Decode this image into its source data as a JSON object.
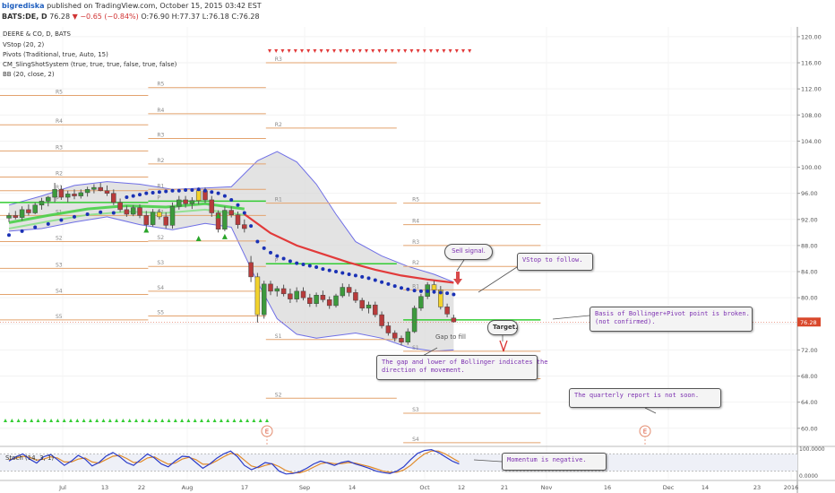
{
  "header": {
    "author": "bigrediska",
    "published": "published on TradingView.com, October 15, 2015 03:42 EST",
    "symbol": "BATS:DE, D",
    "last": "76.28",
    "change": "▼ −0.65 (−0.84%)",
    "ohlc": "O:76.90 H:77.37 L:76.18 C:76.28"
  },
  "indicators": [
    "DEERE & CO, D, BATS",
    "VStop (20, 2)",
    "Pivots (Traditional, true, Auto, 15)",
    "CM_SlingShotSystem (true, true, true, false, true, false)",
    "BB (20, close, 2)"
  ],
  "stoch_label": "Stoch (14, 3, 1)",
  "colors": {
    "up": "#3c9a3c",
    "down": "#b83b3b",
    "slingshot_yellow": "#f2d22c",
    "vstop": "#1a31b5",
    "ema_red": "#e23a3a",
    "ema_green": "#3fcf3f",
    "pivot_line": "#e3a36e",
    "pivot_p": "#33cc33",
    "bb_fill": "#d9d9d9",
    "bb_line": "#6f6fe6",
    "last_price": "#d9482b"
  },
  "annotations": {
    "sell_signal": "Sell signal.",
    "vstop": "VStop to follow.",
    "basis": "Basis of Bollinger+Pivot point is broken.\n(not confirmed).",
    "target": "Target.",
    "gap_fill": "Gap to fill",
    "gap_bollinger": "The gap and lower of Bollinger indicates the\ndirection of movement.",
    "quarterly": "The quarterly report  is not soon.",
    "momentum": "Momentum is negative.",
    "earnings": "E"
  },
  "chart_data": {
    "type": "candlestick",
    "title": "DEERE & CO, D, BATS",
    "y_range": [
      57.5,
      121.5
    ],
    "yticks": [
      60.0,
      64.0,
      68.0,
      72.0,
      76.0,
      80.0,
      84.0,
      88.0,
      92.0,
      96.0,
      100.0,
      104.0,
      108.0,
      112.0,
      116.0,
      120.0
    ],
    "x_ticks": [
      "Jul",
      "13",
      "22",
      "Aug",
      "17",
      "Sep",
      "14",
      "Oct",
      "12",
      "21",
      "Nov",
      "16",
      "Dec",
      "14",
      "23",
      "2016"
    ],
    "last_price": 76.28,
    "candles": [
      {
        "o": 92.2,
        "h": 93.0,
        "l": 91.6,
        "c": 92.6
      },
      {
        "o": 92.6,
        "h": 93.3,
        "l": 92.0,
        "c": 92.3
      },
      {
        "o": 92.3,
        "h": 94.0,
        "l": 91.8,
        "c": 93.5
      },
      {
        "o": 93.5,
        "h": 94.3,
        "l": 92.6,
        "c": 93.0
      },
      {
        "o": 93.0,
        "h": 94.6,
        "l": 92.8,
        "c": 94.2
      },
      {
        "o": 94.2,
        "h": 95.3,
        "l": 93.5,
        "c": 94.8
      },
      {
        "o": 94.8,
        "h": 95.6,
        "l": 94.0,
        "c": 95.4
      },
      {
        "o": 95.4,
        "h": 97.6,
        "l": 94.6,
        "c": 96.6
      },
      {
        "o": 96.6,
        "h": 97.2,
        "l": 95.0,
        "c": 95.4
      },
      {
        "o": 95.4,
        "h": 96.4,
        "l": 94.6,
        "c": 95.9
      },
      {
        "o": 95.9,
        "h": 96.6,
        "l": 95.1,
        "c": 95.6
      },
      {
        "o": 95.6,
        "h": 96.6,
        "l": 95.2,
        "c": 96.1
      },
      {
        "o": 96.1,
        "h": 97.0,
        "l": 95.5,
        "c": 96.6
      },
      {
        "o": 96.6,
        "h": 97.4,
        "l": 96.0,
        "c": 96.9
      },
      {
        "o": 96.9,
        "h": 97.6,
        "l": 96.3,
        "c": 96.4
      },
      {
        "o": 96.4,
        "h": 97.2,
        "l": 95.6,
        "c": 96.0
      },
      {
        "o": 96.0,
        "h": 96.6,
        "l": 94.2,
        "c": 94.6
      },
      {
        "o": 94.6,
        "h": 95.2,
        "l": 93.1,
        "c": 93.5
      },
      {
        "o": 93.5,
        "h": 94.1,
        "l": 92.4,
        "c": 92.8
      },
      {
        "o": 92.8,
        "h": 94.2,
        "l": 92.5,
        "c": 93.8
      },
      {
        "o": 93.8,
        "h": 94.3,
        "l": 92.2,
        "c": 92.6
      },
      {
        "o": 92.6,
        "h": 93.3,
        "l": 90.6,
        "c": 91.2
      },
      {
        "o": 91.2,
        "h": 93.6,
        "l": 90.9,
        "c": 93.1
      },
      {
        "o": 93.1,
        "h": 93.6,
        "l": 92.0,
        "c": 92.4
      },
      {
        "o": 92.4,
        "h": 93.1,
        "l": 90.6,
        "c": 91.1
      },
      {
        "o": 91.1,
        "h": 94.6,
        "l": 90.6,
        "c": 94.0
      },
      {
        "o": 94.0,
        "h": 95.6,
        "l": 93.5,
        "c": 95.0
      },
      {
        "o": 95.0,
        "h": 95.6,
        "l": 93.8,
        "c": 94.4
      },
      {
        "o": 94.4,
        "h": 95.4,
        "l": 93.6,
        "c": 94.9
      },
      {
        "o": 94.9,
        "h": 96.9,
        "l": 94.3,
        "c": 96.4
      },
      {
        "o": 96.4,
        "h": 96.9,
        "l": 94.5,
        "c": 95.0
      },
      {
        "o": 95.0,
        "h": 95.6,
        "l": 92.4,
        "c": 93.0
      },
      {
        "o": 93.0,
        "h": 93.4,
        "l": 90.0,
        "c": 90.5
      },
      {
        "o": 90.5,
        "h": 94.0,
        "l": 90.2,
        "c": 93.4
      },
      {
        "o": 93.4,
        "h": 94.0,
        "l": 92.3,
        "c": 92.7
      },
      {
        "o": 92.7,
        "h": 93.2,
        "l": 90.6,
        "c": 91.2
      },
      {
        "o": 91.2,
        "h": 92.0,
        "l": 90.0,
        "c": 90.6
      },
      {
        "o": 85.4,
        "h": 86.4,
        "l": 82.4,
        "c": 83.2
      },
      {
        "o": 83.2,
        "h": 83.8,
        "l": 76.2,
        "c": 77.4
      },
      {
        "o": 77.4,
        "h": 82.6,
        "l": 76.8,
        "c": 82.1
      },
      {
        "o": 82.1,
        "h": 82.6,
        "l": 80.4,
        "c": 81.0
      },
      {
        "o": 81.0,
        "h": 81.8,
        "l": 80.2,
        "c": 81.4
      },
      {
        "o": 81.4,
        "h": 82.0,
        "l": 80.2,
        "c": 80.6
      },
      {
        "o": 80.6,
        "h": 81.4,
        "l": 79.2,
        "c": 79.8
      },
      {
        "o": 79.8,
        "h": 81.6,
        "l": 79.3,
        "c": 81.0
      },
      {
        "o": 81.0,
        "h": 81.6,
        "l": 79.6,
        "c": 80.0
      },
      {
        "o": 80.0,
        "h": 80.6,
        "l": 78.6,
        "c": 79.1
      },
      {
        "o": 79.1,
        "h": 80.8,
        "l": 78.6,
        "c": 80.4
      },
      {
        "o": 80.4,
        "h": 81.1,
        "l": 79.3,
        "c": 79.7
      },
      {
        "o": 79.7,
        "h": 80.2,
        "l": 78.3,
        "c": 78.8
      },
      {
        "o": 78.8,
        "h": 80.6,
        "l": 78.5,
        "c": 80.3
      },
      {
        "o": 80.3,
        "h": 82.2,
        "l": 80.0,
        "c": 81.6
      },
      {
        "o": 81.6,
        "h": 82.1,
        "l": 80.2,
        "c": 80.8
      },
      {
        "o": 80.8,
        "h": 81.3,
        "l": 79.2,
        "c": 79.6
      },
      {
        "o": 79.6,
        "h": 80.0,
        "l": 78.0,
        "c": 78.4
      },
      {
        "o": 78.4,
        "h": 79.4,
        "l": 77.6,
        "c": 78.9
      },
      {
        "o": 78.9,
        "h": 79.4,
        "l": 77.0,
        "c": 77.4
      },
      {
        "o": 77.4,
        "h": 77.9,
        "l": 75.3,
        "c": 75.7
      },
      {
        "o": 75.7,
        "h": 76.3,
        "l": 74.2,
        "c": 74.6
      },
      {
        "o": 74.6,
        "h": 75.0,
        "l": 73.3,
        "c": 73.8
      },
      {
        "o": 73.8,
        "h": 74.2,
        "l": 72.7,
        "c": 73.2
      },
      {
        "o": 73.2,
        "h": 75.3,
        "l": 72.8,
        "c": 74.8
      },
      {
        "o": 74.8,
        "h": 78.8,
        "l": 74.6,
        "c": 78.4
      },
      {
        "o": 78.4,
        "h": 80.6,
        "l": 78.0,
        "c": 80.2
      },
      {
        "o": 80.2,
        "h": 82.4,
        "l": 79.8,
        "c": 82.0
      },
      {
        "o": 82.0,
        "h": 82.6,
        "l": 80.6,
        "c": 81.2
      },
      {
        "o": 81.2,
        "h": 81.8,
        "l": 78.2,
        "c": 78.6
      },
      {
        "o": 78.6,
        "h": 79.1,
        "l": 77.0,
        "c": 77.5
      },
      {
        "o": 76.9,
        "h": 77.4,
        "l": 76.2,
        "c": 76.3
      }
    ],
    "vstop": [
      {
        "i": 0,
        "v": 89.6
      },
      {
        "i": 2,
        "v": 90.2
      },
      {
        "i": 4,
        "v": 90.8
      },
      {
        "i": 6,
        "v": 91.3
      },
      {
        "i": 8,
        "v": 91.9
      },
      {
        "i": 10,
        "v": 92.4
      },
      {
        "i": 12,
        "v": 92.8
      },
      {
        "i": 14,
        "v": 93.1
      },
      {
        "i": 16,
        "v": 93.0
      },
      {
        "i": 18,
        "v": 95.4
      },
      {
        "i": 19,
        "v": 95.6
      },
      {
        "i": 20,
        "v": 95.8
      },
      {
        "i": 21,
        "v": 96.0
      },
      {
        "i": 22,
        "v": 96.1
      },
      {
        "i": 23,
        "v": 96.2
      },
      {
        "i": 24,
        "v": 96.3
      },
      {
        "i": 25,
        "v": 96.4
      },
      {
        "i": 26,
        "v": 96.4
      },
      {
        "i": 27,
        "v": 96.5
      },
      {
        "i": 28,
        "v": 96.5
      },
      {
        "i": 29,
        "v": 96.6
      },
      {
        "i": 30,
        "v": 96.4
      },
      {
        "i": 31,
        "v": 96.2
      },
      {
        "i": 32,
        "v": 96.0
      },
      {
        "i": 33,
        "v": 95.6
      },
      {
        "i": 34,
        "v": 95.0
      },
      {
        "i": 35,
        "v": 94.2
      },
      {
        "i": 36,
        "v": 93.0
      },
      {
        "i": 37,
        "v": 91.0
      },
      {
        "i": 38,
        "v": 88.6
      },
      {
        "i": 39,
        "v": 87.6
      },
      {
        "i": 40,
        "v": 86.9
      },
      {
        "i": 41,
        "v": 86.4
      },
      {
        "i": 42,
        "v": 86.0
      },
      {
        "i": 43,
        "v": 85.6
      },
      {
        "i": 44,
        "v": 85.3
      },
      {
        "i": 45,
        "v": 85.1
      },
      {
        "i": 46,
        "v": 84.9
      },
      {
        "i": 47,
        "v": 84.7
      },
      {
        "i": 48,
        "v": 84.4
      },
      {
        "i": 49,
        "v": 84.2
      },
      {
        "i": 50,
        "v": 84.0
      },
      {
        "i": 51,
        "v": 83.8
      },
      {
        "i": 52,
        "v": 83.6
      },
      {
        "i": 53,
        "v": 83.4
      },
      {
        "i": 54,
        "v": 83.2
      },
      {
        "i": 55,
        "v": 83.0
      },
      {
        "i": 56,
        "v": 82.7
      },
      {
        "i": 57,
        "v": 82.4
      },
      {
        "i": 58,
        "v": 82.1
      },
      {
        "i": 59,
        "v": 81.8
      },
      {
        "i": 60,
        "v": 81.5
      },
      {
        "i": 61,
        "v": 81.3
      },
      {
        "i": 62,
        "v": 81.1
      },
      {
        "i": 63,
        "v": 81.0
      },
      {
        "i": 64,
        "v": 81.0
      },
      {
        "i": 65,
        "v": 80.9
      },
      {
        "i": 66,
        "v": 80.8
      },
      {
        "i": 67,
        "v": 80.7
      },
      {
        "i": 68,
        "v": 80.5
      }
    ],
    "ema_red": [
      {
        "i": 36,
        "v": 92.8
      },
      {
        "i": 40,
        "v": 89.9
      },
      {
        "i": 44,
        "v": 88.0
      },
      {
        "i": 48,
        "v": 86.7
      },
      {
        "i": 52,
        "v": 85.4
      },
      {
        "i": 56,
        "v": 84.3
      },
      {
        "i": 60,
        "v": 83.4
      },
      {
        "i": 64,
        "v": 82.8
      },
      {
        "i": 68,
        "v": 82.3
      }
    ],
    "ema_green": [
      {
        "i": 0,
        "v": 91.5
      },
      {
        "i": 6,
        "v": 92.6
      },
      {
        "i": 12,
        "v": 93.6
      },
      {
        "i": 18,
        "v": 94.1
      },
      {
        "i": 24,
        "v": 93.9
      },
      {
        "i": 30,
        "v": 94.4
      },
      {
        "i": 36,
        "v": 93.6
      }
    ],
    "bb_upper": [
      {
        "i": 0,
        "v": 94.2
      },
      {
        "i": 5,
        "v": 95.6
      },
      {
        "i": 10,
        "v": 97.2
      },
      {
        "i": 15,
        "v": 97.8
      },
      {
        "i": 20,
        "v": 97.4
      },
      {
        "i": 25,
        "v": 96.6
      },
      {
        "i": 30,
        "v": 96.8
      },
      {
        "i": 34,
        "v": 97.0
      },
      {
        "i": 38,
        "v": 101.0
      },
      {
        "i": 41,
        "v": 102.4
      },
      {
        "i": 44,
        "v": 100.8
      },
      {
        "i": 47,
        "v": 97.4
      },
      {
        "i": 50,
        "v": 92.8
      },
      {
        "i": 53,
        "v": 88.6
      },
      {
        "i": 57,
        "v": 86.4
      },
      {
        "i": 61,
        "v": 84.8
      },
      {
        "i": 65,
        "v": 83.6
      },
      {
        "i": 68,
        "v": 82.4
      }
    ],
    "bb_lower": [
      {
        "i": 0,
        "v": 90.2
      },
      {
        "i": 5,
        "v": 90.6
      },
      {
        "i": 10,
        "v": 91.6
      },
      {
        "i": 15,
        "v": 92.4
      },
      {
        "i": 20,
        "v": 91.2
      },
      {
        "i": 25,
        "v": 90.4
      },
      {
        "i": 30,
        "v": 91.4
      },
      {
        "i": 34,
        "v": 90.8
      },
      {
        "i": 38,
        "v": 82.4
      },
      {
        "i": 41,
        "v": 76.8
      },
      {
        "i": 44,
        "v": 74.4
      },
      {
        "i": 47,
        "v": 73.8
      },
      {
        "i": 50,
        "v": 74.2
      },
      {
        "i": 53,
        "v": 74.6
      },
      {
        "i": 57,
        "v": 73.8
      },
      {
        "i": 61,
        "v": 72.4
      },
      {
        "i": 65,
        "v": 71.8
      },
      {
        "i": 68,
        "v": 72.0
      }
    ],
    "pivot_blocks": [
      {
        "label_x": -1,
        "start": -1,
        "end": 18,
        "levels": [
          {
            "n": "R5",
            "v": 111.0
          },
          {
            "n": "R4",
            "v": 106.5
          },
          {
            "n": "R3",
            "v": 102.5
          },
          {
            "n": "R2",
            "v": 98.5
          },
          {
            "n": "R1",
            "v": 96.4
          },
          {
            "n": "P",
            "v": 94.6
          },
          {
            "n": "S1",
            "v": 92.6
          },
          {
            "n": "S2",
            "v": 88.6
          },
          {
            "n": "S3",
            "v": 84.5
          },
          {
            "n": "S4",
            "v": 80.5
          },
          {
            "n": "S5",
            "v": 76.6
          }
        ]
      },
      {
        "label_x": 18,
        "start": 18,
        "end": 36,
        "levels": [
          {
            "n": "R5",
            "v": 112.2
          },
          {
            "n": "R4",
            "v": 108.2
          },
          {
            "n": "R3",
            "v": 104.4
          },
          {
            "n": "R2",
            "v": 100.5
          },
          {
            "n": "R1",
            "v": 96.6
          },
          {
            "n": "P",
            "v": 94.8
          },
          {
            "n": "S1",
            "v": 92.6
          },
          {
            "n": "S2",
            "v": 88.7
          },
          {
            "n": "S3",
            "v": 84.8
          },
          {
            "n": "S4",
            "v": 81.0
          },
          {
            "n": "S5",
            "v": 77.2
          }
        ]
      },
      {
        "label_x": 36,
        "start": 36,
        "end": 56,
        "levels": [
          {
            "n": "R3",
            "v": 116.0
          },
          {
            "n": "R2",
            "v": 106.0
          },
          {
            "n": "R1",
            "v": 94.5
          },
          {
            "n": "P",
            "v": 85.2
          },
          {
            "n": "S1",
            "v": 73.6
          },
          {
            "n": "S2",
            "v": 64.6
          },
          {
            "n": "S3",
            "v": 51.0
          }
        ]
      },
      {
        "label_x": 57,
        "start": 57,
        "end": 78,
        "levels": [
          {
            "n": "R5",
            "v": 94.5
          },
          {
            "n": "R4",
            "v": 91.2
          },
          {
            "n": "R3",
            "v": 88.0
          },
          {
            "n": "R2",
            "v": 84.8
          },
          {
            "n": "R1",
            "v": 81.2
          },
          {
            "n": "P",
            "v": 76.6
          },
          {
            "n": "S1",
            "v": 71.8
          },
          {
            "n": "S2",
            "v": 67.6
          },
          {
            "n": "S3",
            "v": 62.3
          },
          {
            "n": "S4",
            "v": 57.8
          }
        ]
      }
    ],
    "stoch": {
      "k": [
        55,
        70,
        80,
        62,
        48,
        70,
        78,
        60,
        40,
        55,
        75,
        62,
        38,
        50,
        72,
        85,
        70,
        50,
        40,
        60,
        80,
        66,
        45,
        35,
        55,
        72,
        70,
        50,
        30,
        45,
        65,
        80,
        90,
        70,
        40,
        25,
        35,
        50,
        45,
        20,
        10,
        12,
        18,
        30,
        45,
        55,
        48,
        40,
        50,
        55,
        45,
        38,
        30,
        20,
        15,
        12,
        20,
        35,
        60,
        82,
        92,
        95,
        85,
        70,
        55,
        45
      ],
      "d": [
        60,
        65,
        72,
        68,
        58,
        62,
        70,
        66,
        52,
        52,
        62,
        66,
        52,
        48,
        60,
        72,
        75,
        64,
        50,
        52,
        66,
        70,
        56,
        44,
        48,
        62,
        68,
        60,
        44,
        44,
        56,
        70,
        82,
        78,
        58,
        38,
        32,
        40,
        46,
        36,
        22,
        14,
        14,
        22,
        34,
        46,
        50,
        46,
        46,
        50,
        48,
        42,
        36,
        28,
        20,
        16,
        16,
        24,
        40,
        62,
        80,
        90,
        90,
        80,
        66,
        52
      ],
      "ticks": [
        "100.0000",
        "0.0000"
      ]
    }
  }
}
